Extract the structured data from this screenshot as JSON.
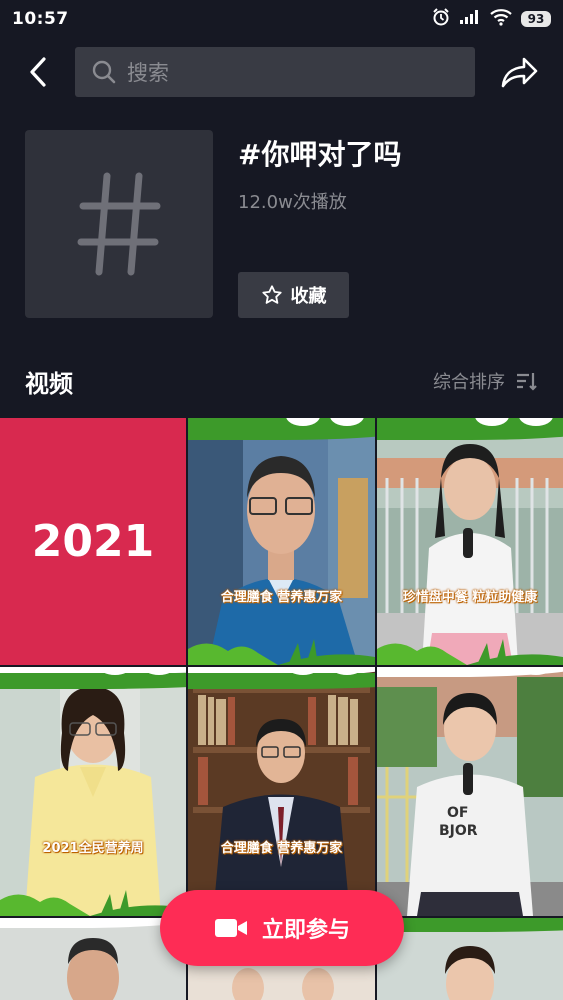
{
  "status_bar": {
    "time": "10:57",
    "battery": "93"
  },
  "search": {
    "placeholder": "搜索"
  },
  "topic": {
    "title": "#你呷对了吗",
    "plays": "12.0w次播放",
    "favorite_label": "收藏"
  },
  "section": {
    "title": "视频",
    "sort_label": "综合排序"
  },
  "videos": [
    {
      "type": "year",
      "text": "2021"
    },
    {
      "type": "scene",
      "caption": "合理膳食 营养惠万家",
      "subject": "man-blue-shirt"
    },
    {
      "type": "scene",
      "caption": "珍惜盘中餐 粒粒助健康",
      "subject": "girl-with-mic"
    },
    {
      "type": "scene",
      "caption": "2021全民营养周",
      "subject": "woman-yellow-blouse"
    },
    {
      "type": "scene",
      "caption": "合理膳食 营养惠万家",
      "subject": "man-suit-bookshelf"
    },
    {
      "type": "scene",
      "caption": "",
      "subject": "boy-with-mic"
    }
  ],
  "join_button": {
    "label": "立即参与"
  },
  "colors": {
    "background": "#161823",
    "accent": "#fe2c55",
    "year_tile": "#d8294f",
    "panel": "#393b44"
  }
}
